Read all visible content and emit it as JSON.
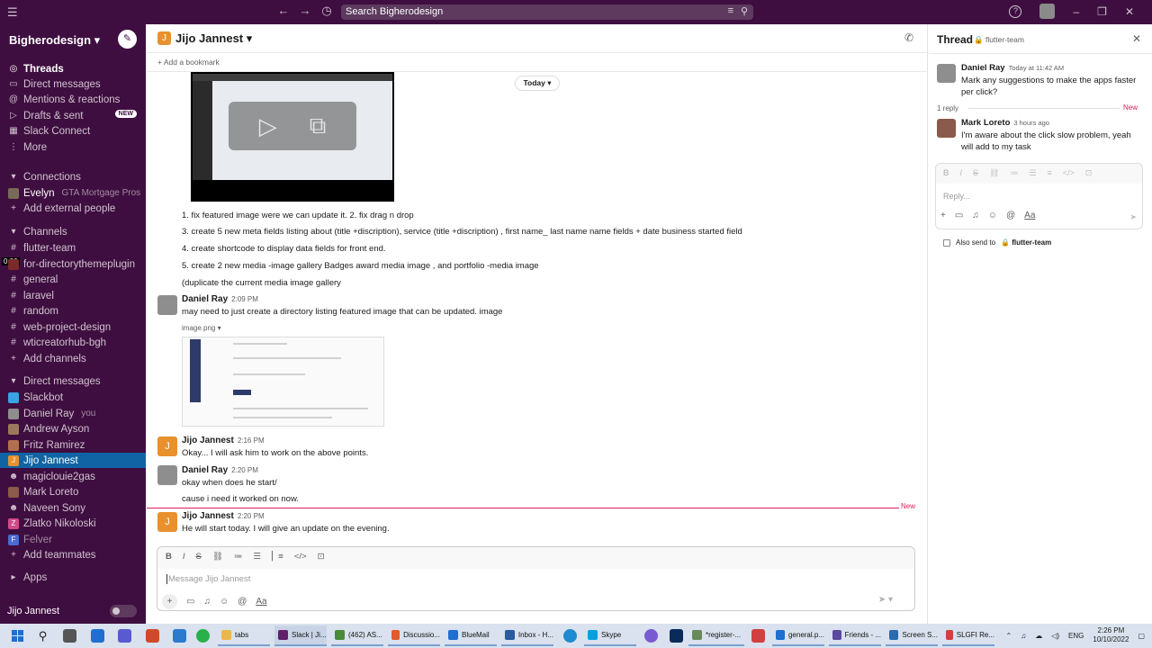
{
  "topbar": {
    "search_placeholder": "Search Bigherodesign"
  },
  "sidebar": {
    "workspace": "Bigherodesign",
    "nav": [
      {
        "label": "Threads",
        "icon": "threads-icon"
      },
      {
        "label": "Direct messages",
        "icon": "dm-icon"
      },
      {
        "label": "Mentions & reactions",
        "icon": "at-icon"
      },
      {
        "label": "Drafts & sent",
        "icon": "send-icon",
        "badge": "NEW"
      },
      {
        "label": "Slack Connect",
        "icon": "building-icon"
      },
      {
        "label": "More",
        "icon": "more-icon"
      }
    ],
    "connections_header": "Connections",
    "connections": [
      {
        "label": "Evelyn",
        "sub": "GTA Mortgage Pros"
      },
      {
        "label": "Add external people"
      }
    ],
    "channels_header": "Channels",
    "channels": [
      "flutter-team",
      "for-directorythemeplugin",
      "general",
      "laravel",
      "random",
      "web-project-design",
      "wticreatorhub-bgh",
      "Add channels"
    ],
    "dm_header": "Direct messages",
    "dms": [
      {
        "label": "Slackbot"
      },
      {
        "label": "Daniel Ray",
        "sub": "you"
      },
      {
        "label": "Andrew Ayson"
      },
      {
        "label": "Fritz Ramirez"
      },
      {
        "label": "Jijo Jannest",
        "active": true
      },
      {
        "label": "magiclouie2gas"
      },
      {
        "label": "Mark Loreto"
      },
      {
        "label": "Naveen Sony"
      },
      {
        "label": "Zlatko Nikoloski"
      },
      {
        "label": "Felver"
      },
      {
        "label": "Add teammates"
      }
    ],
    "apps_header": "Apps",
    "footer_name": "Jijo Jannest",
    "video_time": "0:00"
  },
  "channel": {
    "avatar_letter": "J",
    "name": "Jijo Jannest",
    "bookmark": "Add a bookmark",
    "today": "Today"
  },
  "messages": {
    "list_line1": "1.   fix featured image  were we can update it.   2. fix drag n drop",
    "line3": "3. create 5 new meta fields  listing     about (title +discription), service (title +discription) ,  first name_ last name  name fields + date business started field",
    "line4": "4. create shortcode to display data fields for front end.",
    "line5": "5. create 2 new media -image gallery    Badges award media image , and portfolio -media image",
    "line6": "(duplicate the current media image gallery",
    "m1_name": "Daniel Ray",
    "m1_time": "2:09 PM",
    "m1_text": "may need to just create a directory listing featured image that can be updated. image",
    "m1_file": "image.png",
    "m2_name": "Jijo Jannest",
    "m2_time": "2:16 PM",
    "m2_text": "Okay... I will ask him to work on the above points.",
    "m3_name": "Daniel Ray",
    "m3_time": "2:20 PM",
    "m3_text1": "okay when does he start/",
    "m3_text2": "cause i need it worked on now.",
    "new_label": "New",
    "m4_name": "Jijo Jannest",
    "m4_time": "2:20 PM",
    "m4_text": "He will start today. I will give an update on the evening."
  },
  "composer": {
    "placeholder": "Message Jijo Jannest"
  },
  "thread": {
    "title": "Thread",
    "channel": "flutter-team",
    "p1_name": "Daniel Ray",
    "p1_time": "Today at 11:42 AM",
    "p1_text": "Mark any suggestions to make the apps faster per click?",
    "reply_count": "1 reply",
    "new_label": "New",
    "p2_name": "Mark Loreto",
    "p2_time": "3 hours ago",
    "p2_text": "I'm aware about the click slow problem, yeah will add to my task",
    "reply_placeholder": "Reply...",
    "also_send": "Also send to",
    "also_channel": "flutter-team"
  },
  "taskbar": {
    "apps": [
      {
        "label": "tabs",
        "color": "#e8b84a"
      },
      {
        "label": "Slack | Ji...",
        "color": "#611f69"
      },
      {
        "label": "(462) AS...",
        "color": "#4a8a3a"
      },
      {
        "label": "Discussio...",
        "color": "#e25a2a"
      },
      {
        "label": "BlueMail",
        "color": "#1e6fd0"
      },
      {
        "label": "Inbox - H...",
        "color": "#2a5aa0"
      },
      {
        "label": "Skype",
        "color": "#0aa0e0"
      },
      {
        "label": "*register-...",
        "color": "#6a8a5a"
      },
      {
        "label": "general.p...",
        "color": "#1e6fd0"
      },
      {
        "label": "Friends - ...",
        "color": "#5a4aa0"
      },
      {
        "label": "Screen S...",
        "color": "#2a6ab0"
      },
      {
        "label": "SLGFI Re...",
        "color": "#d04040"
      }
    ],
    "lang": "ENG",
    "time": "2:26 PM",
    "date": "10/10/2022"
  }
}
